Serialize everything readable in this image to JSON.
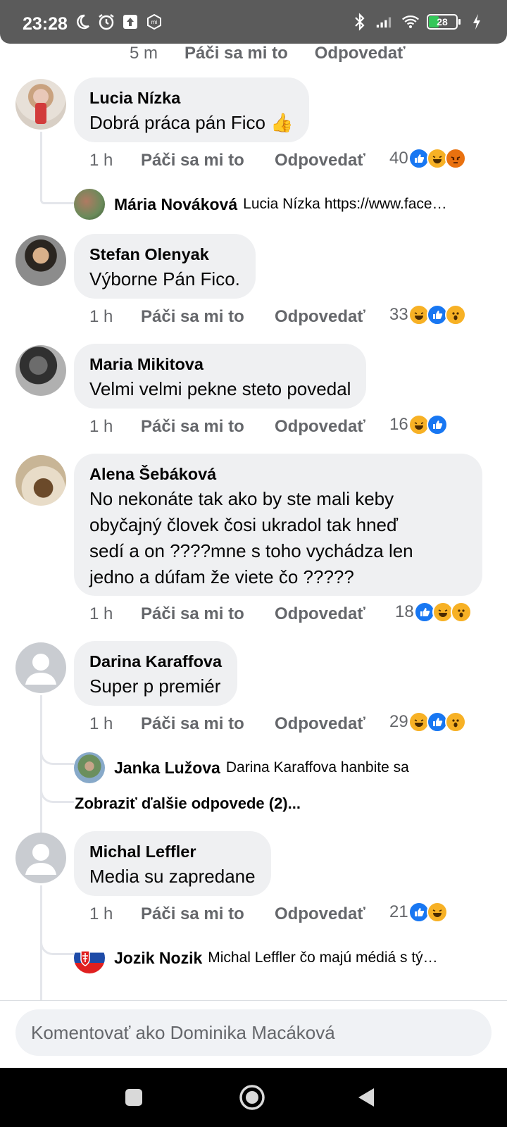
{
  "status_bar": {
    "time": "23:28",
    "battery": "28",
    "left_icons": [
      "moon-icon",
      "alarm-icon",
      "upload-icon",
      "mi-icon"
    ],
    "right_icons": [
      "bluetooth-icon",
      "signal-icon",
      "wifi-icon",
      "battery-icon",
      "charging-icon"
    ]
  },
  "top_actions": {
    "time": "5 m",
    "like": "Páči sa mi to",
    "reply": "Odpovedať"
  },
  "comments": [
    {
      "name": "Lucia Nízka",
      "text": "Dobrá práca pán Fico 👍",
      "time": "1 h",
      "like": "Páči sa mi to",
      "reply": "Odpovedať",
      "reaction_count": "40",
      "reactions": [
        "like",
        "haha",
        "angry"
      ],
      "replies": [
        {
          "name": "Mária Nováková",
          "text": "Lucia Nízka https://www.face…"
        }
      ]
    },
    {
      "name": "Stefan Olenyak",
      "text": "Výborne Pán Fico.",
      "time": "1 h",
      "like": "Páči sa mi to",
      "reply": "Odpovedať",
      "reaction_count": "33",
      "reactions": [
        "haha",
        "like",
        "wow"
      ]
    },
    {
      "name": "Maria Mikitova",
      "text": "Velmi velmi pekne steto povedal",
      "time": "1 h",
      "like": "Páči sa mi to",
      "reply": "Odpovedať",
      "reaction_count": "16",
      "reactions": [
        "haha",
        "like"
      ]
    },
    {
      "name": "Alena Šebáková",
      "text_lines": [
        "No nekonáte tak ako by ste mali keby",
        "obyčajný človek čosi ukradol tak hneď",
        "sedí a on ????mne s toho vychádza len",
        "jedno a dúfam že viete čo ?????"
      ],
      "time": "1 h",
      "like": "Páči sa mi to",
      "reply": "Odpovedať",
      "reaction_count": "18",
      "reactions": [
        "like",
        "haha",
        "wow"
      ]
    },
    {
      "name": "Darina Karaffova",
      "text": "Super p premiér",
      "time": "1 h",
      "like": "Páči sa mi to",
      "reply": "Odpovedať",
      "reaction_count": "29",
      "reactions": [
        "haha",
        "like",
        "wow"
      ],
      "replies": [
        {
          "name": "Janka Lužova",
          "text": "Darina Karaffova hanbite sa"
        }
      ],
      "more_replies": "Zobraziť ďalšie odpovede (2)..."
    },
    {
      "name": "Michal Leffler",
      "text": "Media su zapredane",
      "time": "1 h",
      "like": "Páči sa mi to",
      "reply": "Odpovedať",
      "reaction_count": "21",
      "reactions": [
        "like",
        "haha"
      ],
      "replies": [
        {
          "name": "Jozik Nozik",
          "text": "Michal Leffler čo majú médiá s tý…"
        }
      ]
    }
  ],
  "comment_input": {
    "placeholder": "Komentovať ako Dominika Macáková"
  },
  "nav": [
    "recent-apps-icon",
    "home-icon",
    "back-icon"
  ],
  "colors": {
    "accent": "#1877f2",
    "bubble": "#eff0f2",
    "muted": "#65676b",
    "status_bar": "#5b5b5b"
  }
}
